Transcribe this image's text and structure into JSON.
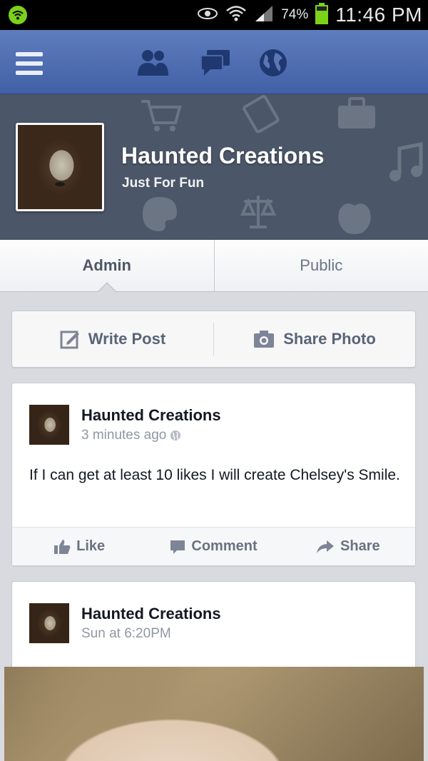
{
  "status_bar": {
    "battery_percent": "74%",
    "time": "11:46 PM"
  },
  "nav": {
    "icons": [
      "menu-icon",
      "friends-icon",
      "messages-icon",
      "globe-icon"
    ]
  },
  "page": {
    "name": "Haunted Creations",
    "category": "Just For Fun"
  },
  "tabs": [
    {
      "label": "Admin",
      "active": true
    },
    {
      "label": "Public",
      "active": false
    }
  ],
  "composer": {
    "write_post": "Write Post",
    "share_photo": "Share Photo"
  },
  "posts": [
    {
      "author": "Haunted Creations",
      "time": "3 minutes ago",
      "text": "If I can get at least 10 likes I will create Chelsey's Smile.",
      "actions": {
        "like": "Like",
        "comment": "Comment",
        "share": "Share"
      }
    },
    {
      "author": "Haunted Creations",
      "time": "Sun at 6:20PM"
    }
  ],
  "colors": {
    "nav_bar": "#4a68ad",
    "cover": "#4b5668",
    "background": "#d8dadf",
    "app_indicator": "#7bd21a",
    "battery": "#7bd21a"
  }
}
